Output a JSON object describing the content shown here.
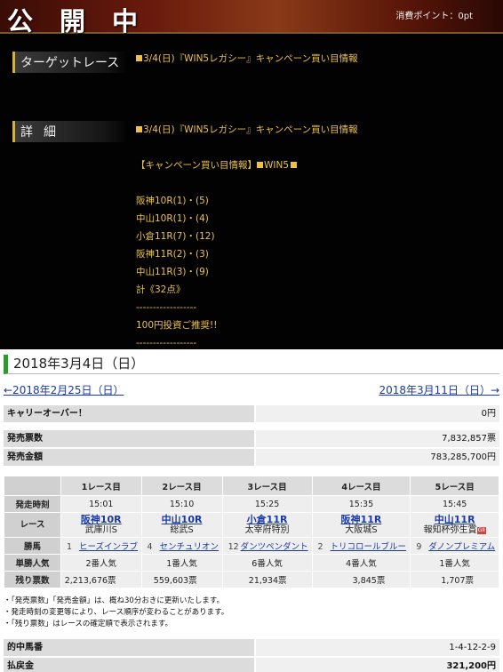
{
  "banner": {
    "title": "公開中",
    "points": "消費ポイント：0pt"
  },
  "labels": {
    "target": "ターゲットレース",
    "detail": "詳細"
  },
  "target_text": "3/4(日)『WIN5レガシー』キャンペーン買い目情報",
  "detail": {
    "line1": "3/4(日)『WIN5レガシー』キャンペーン買い目情報",
    "line2a": "【キャンペーン買い目情報】",
    "line2b": "WIN5",
    "picks": [
      "阪神10R(1)・(5)",
      "中山10R(1)・(4)",
      "小倉11R(7)・(12)",
      "阪神11R(2)・(3)",
      "中山11R(3)・(9)",
      "計《32点》"
    ],
    "sep": "------------------",
    "rec": "100円投資ご推奨!!"
  },
  "date": "2018年3月4日（日）",
  "nav": {
    "prev": "←2018年2月25日（日）",
    "next": "2018年3月11日（日）→"
  },
  "carry": {
    "label": "キャリーオーバー！",
    "value": "0円"
  },
  "sales": {
    "count_label": "発売票数",
    "count": "7,832,857票",
    "amount_label": "発売金額",
    "amount": "783,285,700円"
  },
  "table": {
    "headers": [
      "1レース目",
      "2レース目",
      "3レース目",
      "4レース目",
      "5レース目"
    ],
    "row_labels": [
      "発走時刻",
      "レース",
      "勝馬",
      "単勝人気",
      "残り票数"
    ],
    "times": [
      "15:01",
      "15:10",
      "15:25",
      "15:35",
      "15:45"
    ],
    "races": [
      {
        "venue": "阪神10R",
        "name": "武庫川S",
        "tag": ""
      },
      {
        "venue": "中山10R",
        "name": "総武S",
        "tag": ""
      },
      {
        "venue": "小倉11R",
        "name": "太宰府特別",
        "tag": ""
      },
      {
        "venue": "阪神11R",
        "name": "大阪城S",
        "tag": ""
      },
      {
        "venue": "中山11R",
        "name": "報知杯弥生賞",
        "tag": "GII"
      }
    ],
    "winners": [
      {
        "num": "1",
        "name": "ヒーズインラブ"
      },
      {
        "num": "4",
        "name": "センチュリオン"
      },
      {
        "num": "12",
        "name": "ダンツペンダント"
      },
      {
        "num": "2",
        "name": "トリコロールブルー"
      },
      {
        "num": "9",
        "name": "ダノンプレミアム"
      }
    ],
    "popularity": [
      "2番人気",
      "1番人気",
      "6番人気",
      "4番人気",
      "1番人気"
    ],
    "remaining": [
      "2,213,676票",
      "559,603票",
      "21,934票",
      "3,845票",
      "1,707票"
    ]
  },
  "notes": [
    "・「発売票数」「発売金額」は、概ね30分おきに更新いたします。",
    "・発走時刻の変更等により、レース順序が変わることがあります。",
    "・「残り票数」はレースの確定順で表示されます。"
  ],
  "result": {
    "combo_label": "的中馬番",
    "combo": "1-4-12-2-9",
    "payout_label": "払戻金",
    "payout": "321,200円"
  }
}
